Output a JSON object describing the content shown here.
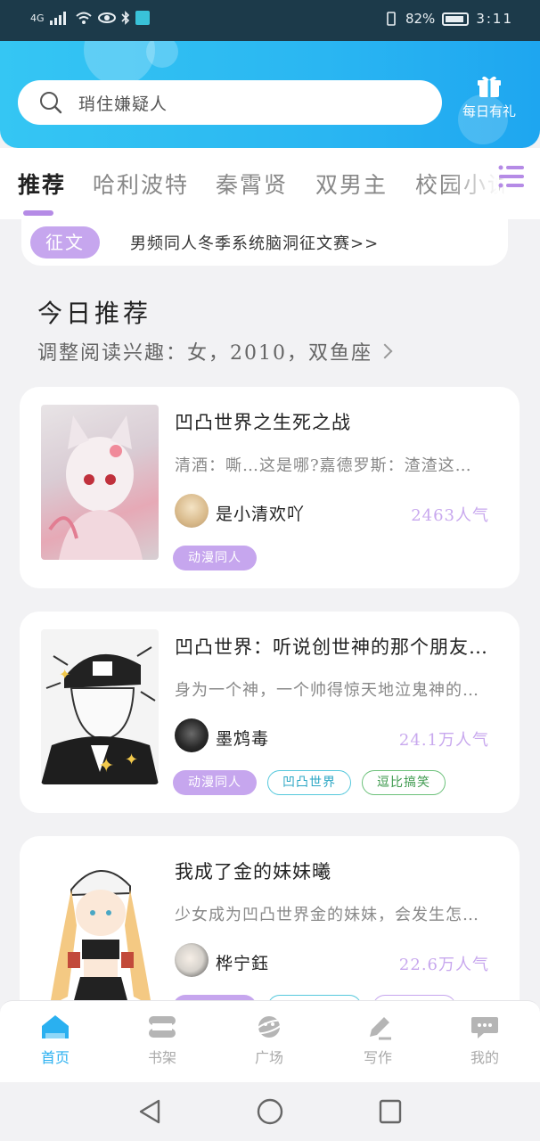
{
  "status_bar": {
    "network": "4G",
    "battery_percent": "82%",
    "time": "3:11"
  },
  "header": {
    "search_placeholder": "琑住嫌疑人",
    "daily_gift_label": "每日有礼"
  },
  "tabs": [
    {
      "label": "推荐",
      "active": true
    },
    {
      "label": "哈利波特",
      "active": false
    },
    {
      "label": "秦霄贤",
      "active": false
    },
    {
      "label": "双男主",
      "active": false
    },
    {
      "label": "校园小说",
      "active": false
    }
  ],
  "contest": {
    "badge": "征文",
    "text": "男频同人冬季系统脑洞征文赛>>"
  },
  "recommend": {
    "title": "今日推荐",
    "interest_line": "调整阅读兴趣：女，2010，双鱼座"
  },
  "books": [
    {
      "title": "凹凸世界之生死之战",
      "desc": "清酒：嘶…这是哪?嘉德罗斯：渣渣这…",
      "author": "是小清欢吖",
      "popularity": "2463人气",
      "tags": [
        {
          "label": "动漫同人",
          "style": "purple"
        }
      ]
    },
    {
      "title": "凹凸世界：听说创世神的那个朋友…",
      "desc": "身为一个神，一个帅得惊天地泣鬼神的…",
      "author": "墨鸩毒",
      "popularity": "24.1万人气",
      "tags": [
        {
          "label": "动漫同人",
          "style": "purple"
        },
        {
          "label": "凹凸世界",
          "style": "cyan"
        },
        {
          "label": "逗比搞笑",
          "style": "green"
        }
      ]
    },
    {
      "title": "我成了金的妹妹曦",
      "desc": "少女成为凹凸世界金的妹妹，会发生怎…",
      "author": "桦宁鈺",
      "popularity": "22.6万人气",
      "tags": [
        {
          "label": "",
          "style": "purple"
        },
        {
          "label": "",
          "style": "cyan"
        },
        {
          "label": "",
          "style": "purple-outline"
        }
      ]
    }
  ],
  "bottom_nav": [
    {
      "label": "首页",
      "icon": "home-icon",
      "active": true
    },
    {
      "label": "书架",
      "icon": "bookshelf-icon",
      "active": false
    },
    {
      "label": "广场",
      "icon": "planet-icon",
      "active": false
    },
    {
      "label": "写作",
      "icon": "pencil-icon",
      "active": false
    },
    {
      "label": "我的",
      "icon": "chat-bubble-icon",
      "active": false
    }
  ],
  "colors": {
    "accent_blue": "#2ab0f0",
    "accent_purple": "#c6a6ee",
    "tab_underline": "#b58be6"
  }
}
